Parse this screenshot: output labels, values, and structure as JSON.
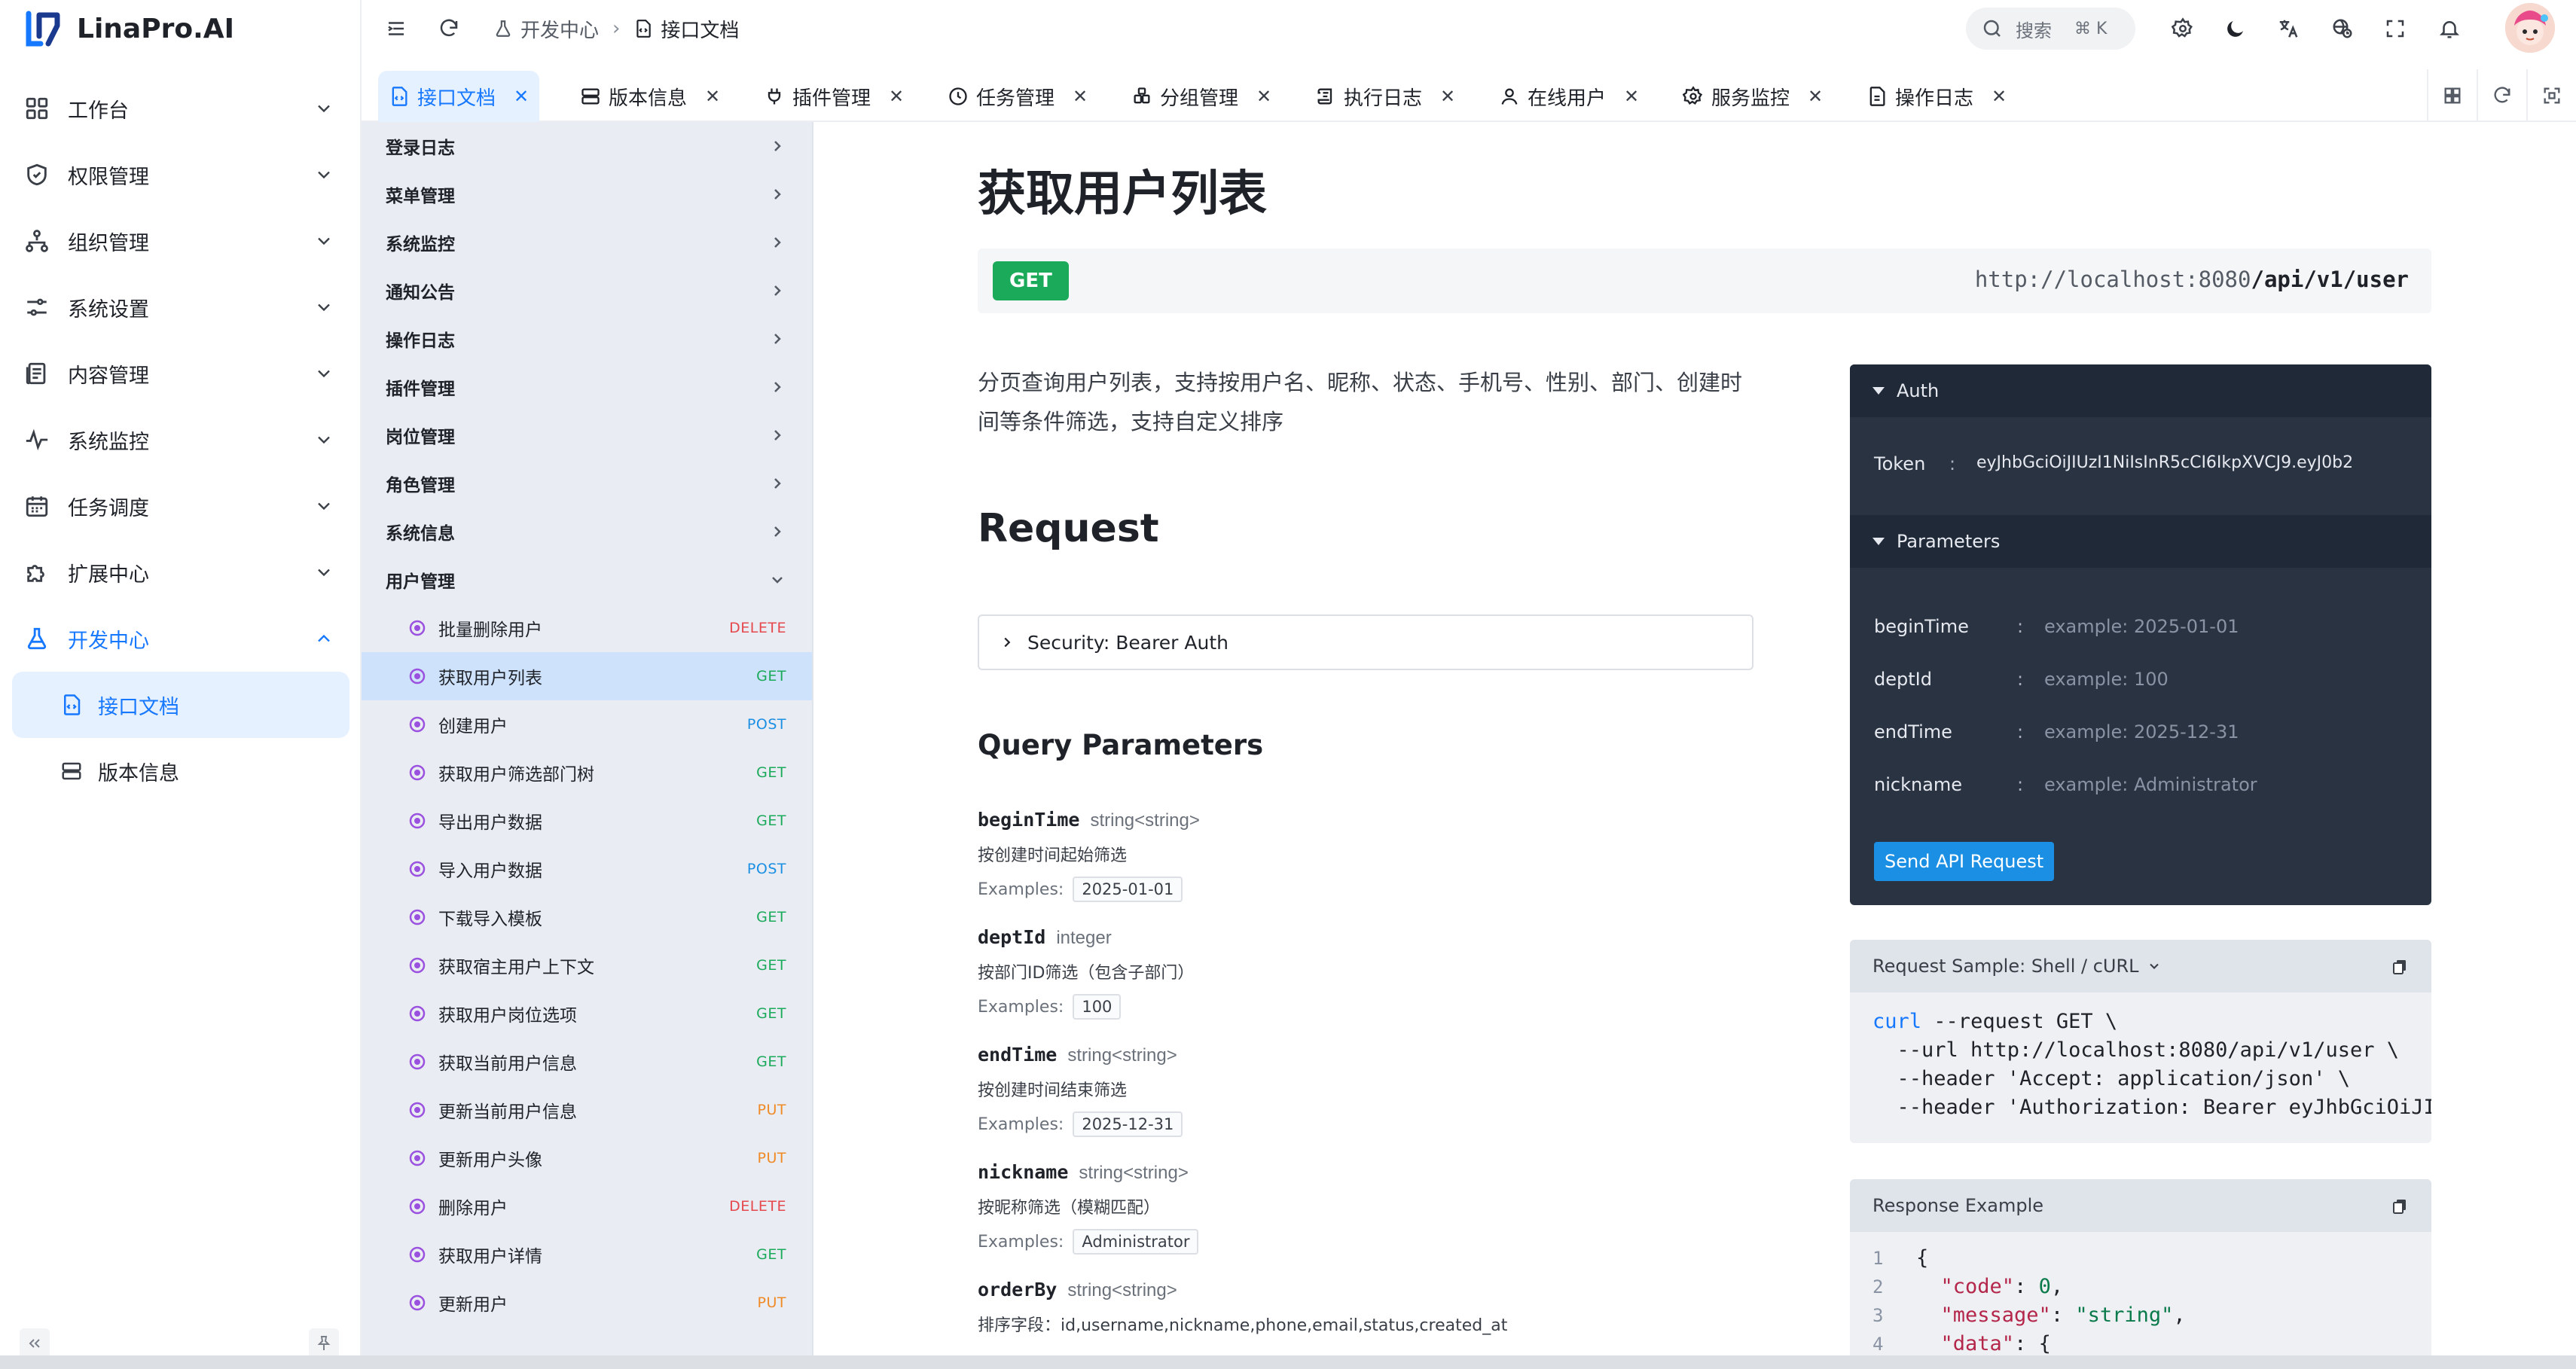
{
  "app": {
    "brand": "LinaPro.AI"
  },
  "sidebar": {
    "items": [
      {
        "label": "工作台",
        "icon": "dashboard-icon"
      },
      {
        "label": "权限管理",
        "icon": "shield-icon"
      },
      {
        "label": "组织管理",
        "icon": "org-tree-icon"
      },
      {
        "label": "系统设置",
        "icon": "sliders-icon"
      },
      {
        "label": "内容管理",
        "icon": "document-icon"
      },
      {
        "label": "系统监控",
        "icon": "pulse-icon"
      },
      {
        "label": "任务调度",
        "icon": "calendar-icon"
      },
      {
        "label": "扩展中心",
        "icon": "puzzle-icon"
      },
      {
        "label": "开发中心",
        "icon": "flask-icon"
      }
    ],
    "children": [
      {
        "label": "接口文档",
        "icon": "doc-code-icon"
      },
      {
        "label": "版本信息",
        "icon": "server-icon"
      }
    ]
  },
  "topbar": {
    "breadcrumb": [
      "开发中心",
      "接口文档"
    ],
    "search_label": "搜索",
    "search_shortcut": "⌘ K"
  },
  "tabs": [
    {
      "label": "接口文档"
    },
    {
      "label": "版本信息"
    },
    {
      "label": "插件管理"
    },
    {
      "label": "任务管理"
    },
    {
      "label": "分组管理"
    },
    {
      "label": "执行日志"
    },
    {
      "label": "在线用户"
    },
    {
      "label": "服务监控"
    },
    {
      "label": "操作日志"
    }
  ],
  "api_groups": [
    "登录日志",
    "菜单管理",
    "系统监控",
    "通知公告",
    "操作日志",
    "插件管理",
    "岗位管理",
    "角色管理",
    "系统信息",
    "用户管理"
  ],
  "api_ops": [
    {
      "label": "批量删除用户",
      "method": "DELETE"
    },
    {
      "label": "获取用户列表",
      "method": "GET"
    },
    {
      "label": "创建用户",
      "method": "POST"
    },
    {
      "label": "获取用户筛选部门树",
      "method": "GET"
    },
    {
      "label": "导出用户数据",
      "method": "GET"
    },
    {
      "label": "导入用户数据",
      "method": "POST"
    },
    {
      "label": "下载导入模板",
      "method": "GET"
    },
    {
      "label": "获取宿主用户上下文",
      "method": "GET"
    },
    {
      "label": "获取用户岗位选项",
      "method": "GET"
    },
    {
      "label": "获取当前用户信息",
      "method": "GET"
    },
    {
      "label": "更新当前用户信息",
      "method": "PUT"
    },
    {
      "label": "更新用户头像",
      "method": "PUT"
    },
    {
      "label": "删除用户",
      "method": "DELETE"
    },
    {
      "label": "获取用户详情",
      "method": "GET"
    },
    {
      "label": "更新用户",
      "method": "PUT"
    }
  ],
  "method_colors": {
    "GET": "#1aaa5a",
    "POST": "#1a8fe3",
    "PUT": "#f08a24",
    "DELETE": "#e5484d"
  },
  "doc": {
    "title": "获取用户列表",
    "method": "GET",
    "url_host": "http://localhost:8080",
    "url_path": "/api/v1/user",
    "description": "分页查询用户列表，支持按用户名、昵称、状态、手机号、性别、部门、创建时间等条件筛选，支持自定义排序",
    "request_heading": "Request",
    "security_label": "Security: Bearer Auth",
    "query_heading": "Query Parameters",
    "examples_label": "Examples:",
    "params": [
      {
        "name": "beginTime",
        "type": "string<string>",
        "desc": "按创建时间起始筛选",
        "example": "2025-01-01"
      },
      {
        "name": "deptId",
        "type": "integer",
        "desc": "按部门ID筛选（包含子部门）",
        "example": "100"
      },
      {
        "name": "endTime",
        "type": "string<string>",
        "desc": "按创建时间结束筛选",
        "example": "2025-12-31"
      },
      {
        "name": "nickname",
        "type": "string<string>",
        "desc": "按昵称筛选（模糊匹配）",
        "example": "Administrator"
      },
      {
        "name": "orderBy",
        "type": "string<string>",
        "desc": "排序字段：id,username,nickname,phone,email,status,created_at",
        "example": ""
      }
    ]
  },
  "console": {
    "auth_heading": "Auth",
    "token_label": "Token",
    "token_value": "eyJhbGciOiJIUzI1NiIsInR5cCI6IkpXVCJ9.eyJ0b2",
    "params_heading": "Parameters",
    "fields": [
      {
        "name": "beginTime",
        "placeholder": "example: 2025-01-01"
      },
      {
        "name": "deptId",
        "placeholder": "example: 100"
      },
      {
        "name": "endTime",
        "placeholder": "example: 2025-12-31"
      },
      {
        "name": "nickname",
        "placeholder": "example: Administrator"
      }
    ],
    "send_label": "Send API Request"
  },
  "sample": {
    "heading": "Request Sample: Shell / cURL",
    "lines": [
      "--request GET \\",
      "  --url http://localhost:8080/api/v1/user \\",
      "  --header 'Accept: application/json' \\",
      "  --header 'Authorization: Bearer eyJhbGciOiJIU"
    ],
    "cmd": "curl"
  },
  "response": {
    "heading": "Response Example",
    "line_numbers": [
      "1",
      "2",
      "3",
      "4"
    ],
    "open_brace": "{",
    "code_key": "\"code\"",
    "code_val": "0",
    "msg_key": "\"message\"",
    "msg_val": "\"string\"",
    "data_key": "\"data\"",
    "data_open": "{"
  }
}
